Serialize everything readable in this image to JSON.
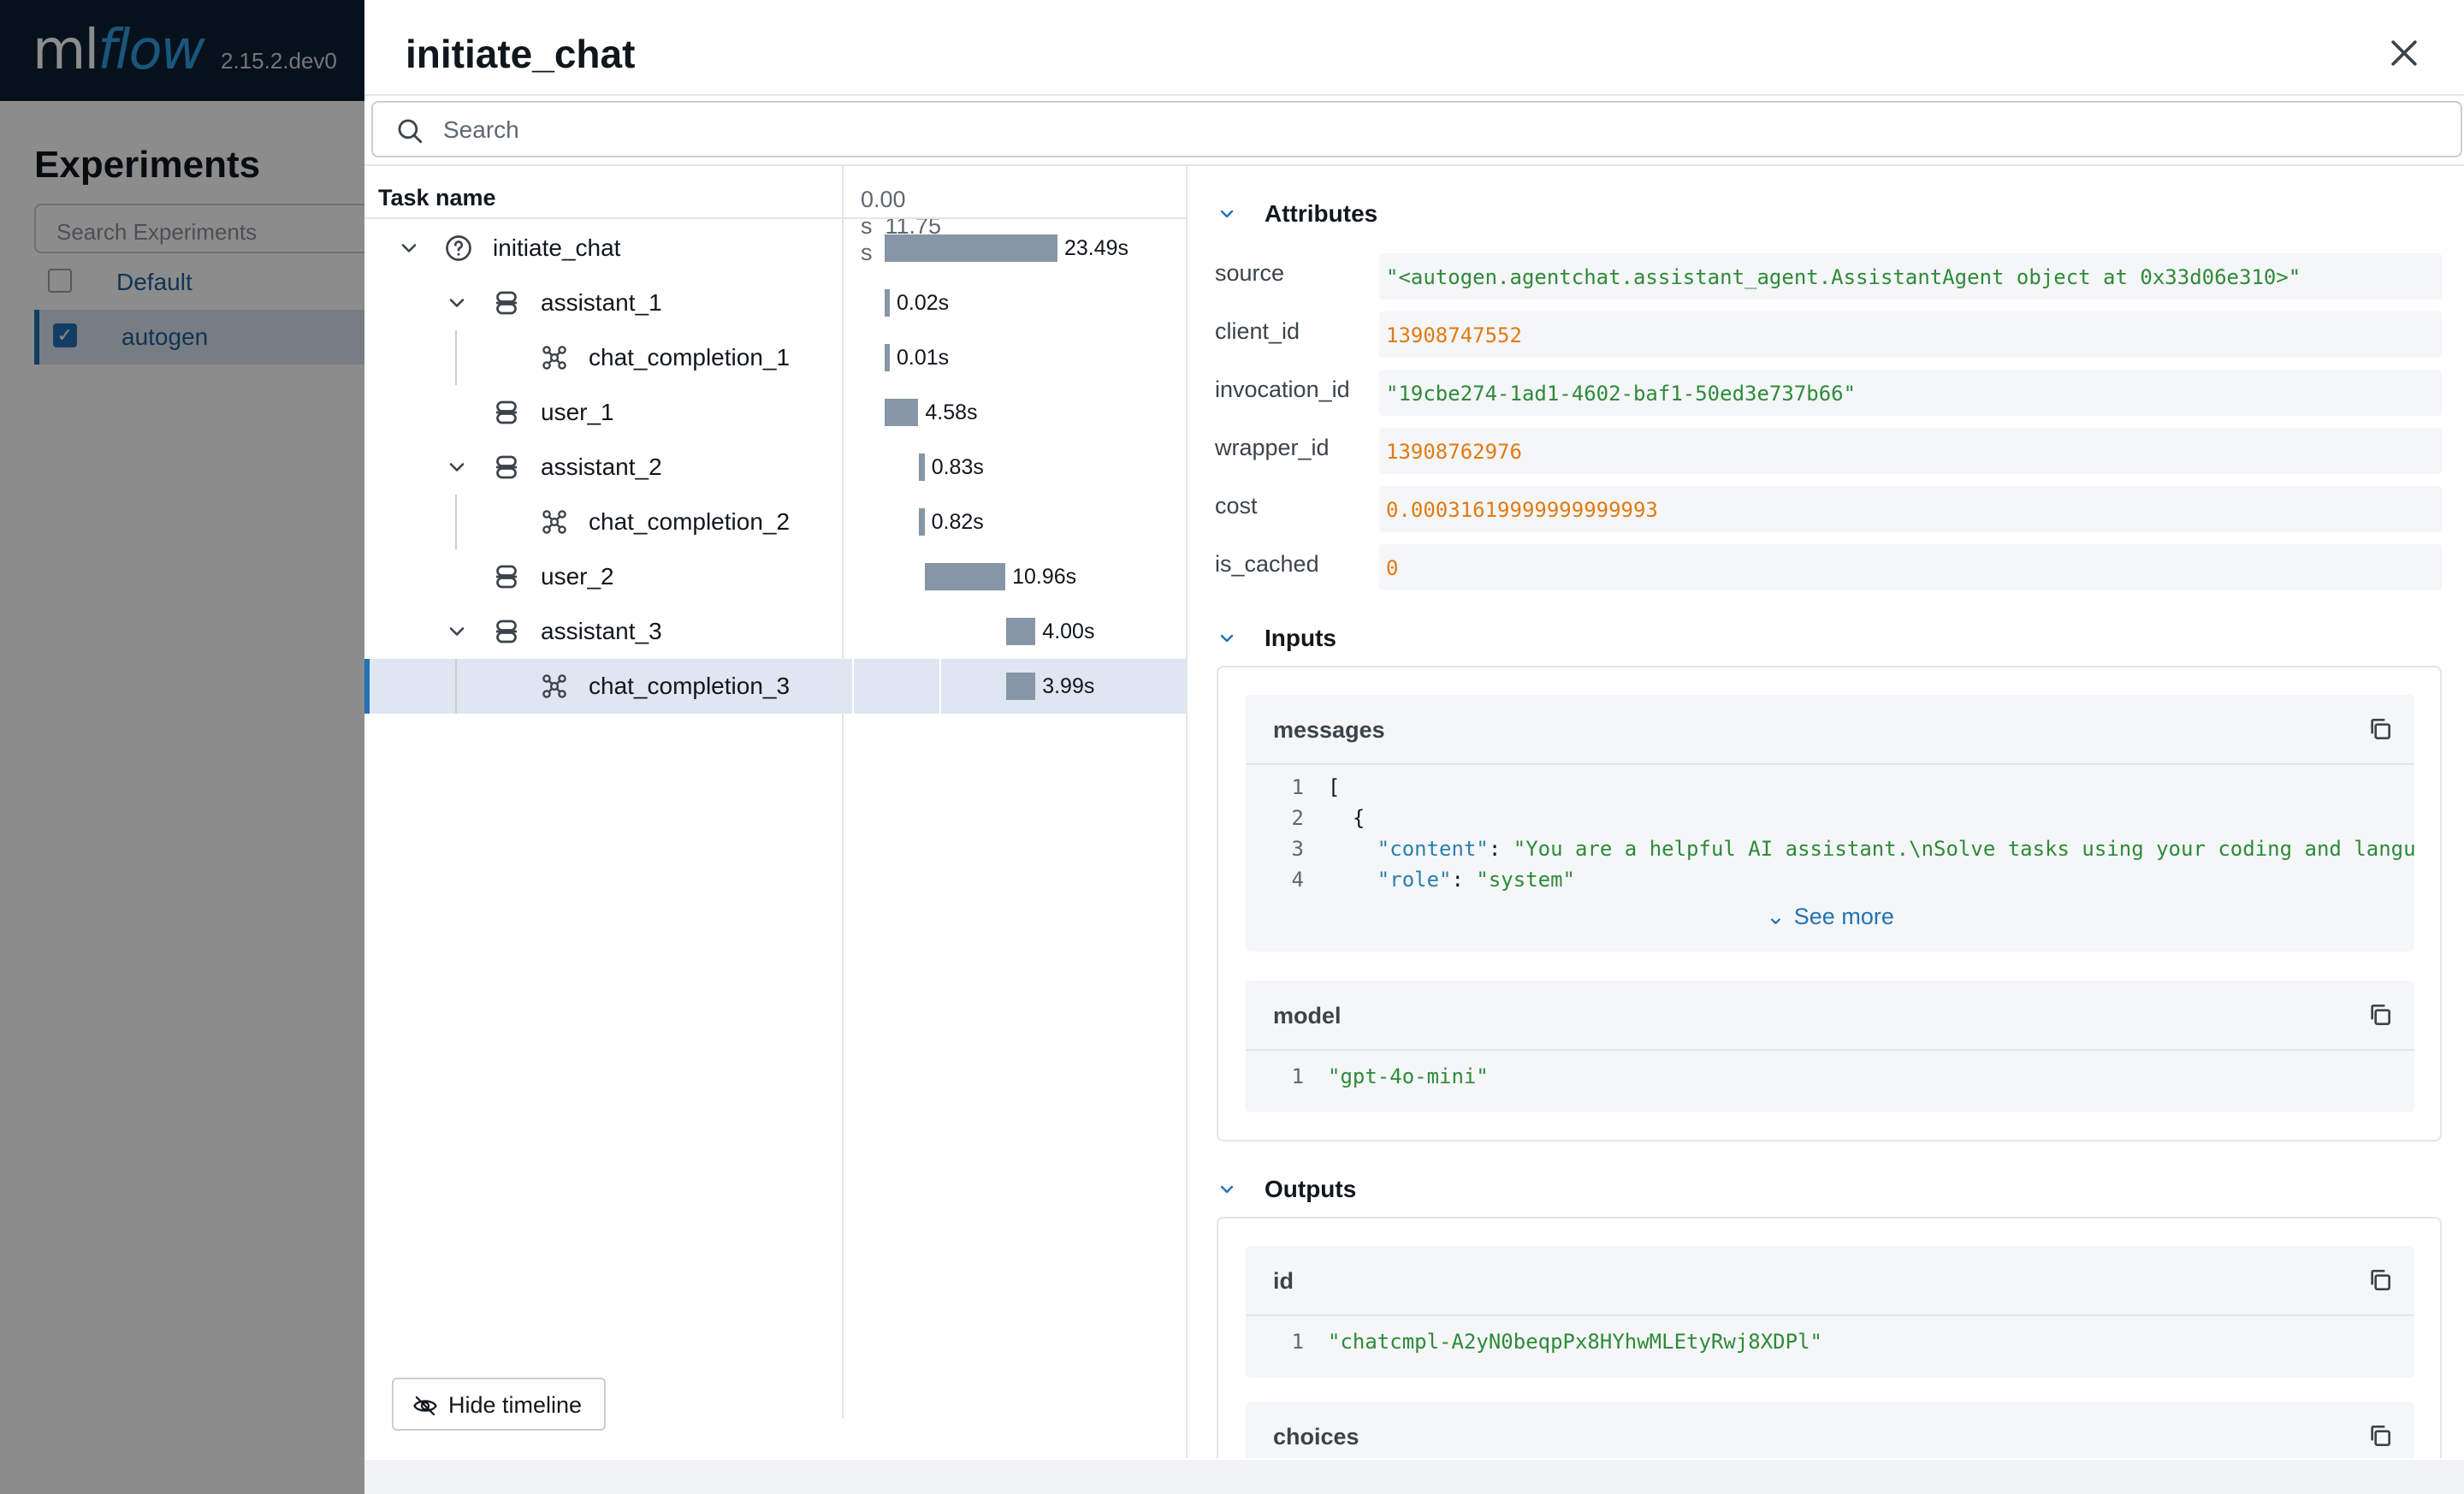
{
  "background_app": {
    "logo_ml": "ml",
    "logo_flow": "flow",
    "version": "2.15.2.dev0",
    "page_title": "Experiments",
    "search_placeholder": "Search Experiments",
    "experiments": [
      {
        "name": "Default",
        "checked": false
      },
      {
        "name": "autogen",
        "checked": true
      }
    ]
  },
  "drawer": {
    "title": "initiate_chat",
    "search_placeholder": "Search",
    "tree_column_header": "Task name",
    "timeline_start": "0.00 s",
    "timeline_end": "11.75 s",
    "hide_timeline_label": "Hide timeline",
    "spans": [
      {
        "name": "initiate_chat",
        "type": "unknown",
        "depth": 0,
        "expandable": true,
        "duration": "23.49s",
        "start": 0.0,
        "length": 23.49,
        "selected": false
      },
      {
        "name": "assistant_1",
        "type": "agent",
        "depth": 1,
        "expandable": true,
        "duration": "0.02s",
        "start": 0.0,
        "length": 0.02,
        "selected": false
      },
      {
        "name": "chat_completion_1",
        "type": "llm",
        "depth": 2,
        "expandable": false,
        "duration": "0.01s",
        "start": 0.0,
        "length": 0.01,
        "selected": false
      },
      {
        "name": "user_1",
        "type": "agent",
        "depth": 1,
        "expandable": false,
        "duration": "4.58s",
        "start": 0.0,
        "length": 4.58,
        "selected": false
      },
      {
        "name": "assistant_2",
        "type": "agent",
        "depth": 1,
        "expandable": true,
        "duration": "0.83s",
        "start": 4.6,
        "length": 0.83,
        "selected": false
      },
      {
        "name": "chat_completion_2",
        "type": "llm",
        "depth": 2,
        "expandable": false,
        "duration": "0.82s",
        "start": 4.6,
        "length": 0.82,
        "selected": false
      },
      {
        "name": "user_2",
        "type": "agent",
        "depth": 1,
        "expandable": false,
        "duration": "10.96s",
        "start": 5.45,
        "length": 10.96,
        "selected": false
      },
      {
        "name": "assistant_3",
        "type": "agent",
        "depth": 1,
        "expandable": true,
        "duration": "4.00s",
        "start": 16.5,
        "length": 4.0,
        "selected": false
      },
      {
        "name": "chat_completion_3",
        "type": "llm",
        "depth": 2,
        "expandable": false,
        "duration": "3.99s",
        "start": 16.5,
        "length": 3.99,
        "selected": true
      }
    ]
  },
  "detail": {
    "attributes_label": "Attributes",
    "attributes": [
      {
        "key": "source",
        "value": "\"<autogen.agentchat.assistant_agent.AssistantAgent object at 0x33d06e310>\"",
        "kind": "str"
      },
      {
        "key": "client_id",
        "value": "13908747552",
        "kind": "num"
      },
      {
        "key": "invocation_id",
        "value": "\"19cbe274-1ad1-4602-baf1-50ed3e737b66\"",
        "kind": "str"
      },
      {
        "key": "wrapper_id",
        "value": "13908762976",
        "kind": "num"
      },
      {
        "key": "cost",
        "value": "0.00031619999999999993",
        "kind": "num"
      },
      {
        "key": "is_cached",
        "value": "0",
        "kind": "num"
      }
    ],
    "inputs_label": "Inputs",
    "inputs": {
      "messages": {
        "name": "messages",
        "lines": [
          {
            "n": "1",
            "parts": [
              {
                "t": "[",
                "c": "plain"
              }
            ]
          },
          {
            "n": "2",
            "parts": [
              {
                "t": "  {",
                "c": "plain"
              }
            ]
          },
          {
            "n": "3",
            "parts": [
              {
                "t": "    \"content\"",
                "c": "key"
              },
              {
                "t": ": ",
                "c": "plain"
              },
              {
                "t": "\"You are a helpful AI assistant.\\nSolve tasks using your coding and langu",
                "c": "str"
              }
            ]
          },
          {
            "n": "4",
            "parts": [
              {
                "t": "    \"role\"",
                "c": "key"
              },
              {
                "t": ": ",
                "c": "plain"
              },
              {
                "t": "\"system\"",
                "c": "str"
              }
            ]
          }
        ],
        "see_more": "See more"
      },
      "model": {
        "name": "model",
        "lines": [
          {
            "n": "1",
            "parts": [
              {
                "t": "\"gpt-4o-mini\"",
                "c": "str"
              }
            ]
          }
        ]
      }
    },
    "outputs_label": "Outputs",
    "outputs": {
      "id": {
        "name": "id",
        "lines": [
          {
            "n": "1",
            "parts": [
              {
                "t": "\"chatcmpl-A2yN0beqpPx8HYhwMLEtyRwj8XDPl\"",
                "c": "str"
              }
            ]
          }
        ]
      },
      "choices": {
        "name": "choices"
      }
    }
  }
}
